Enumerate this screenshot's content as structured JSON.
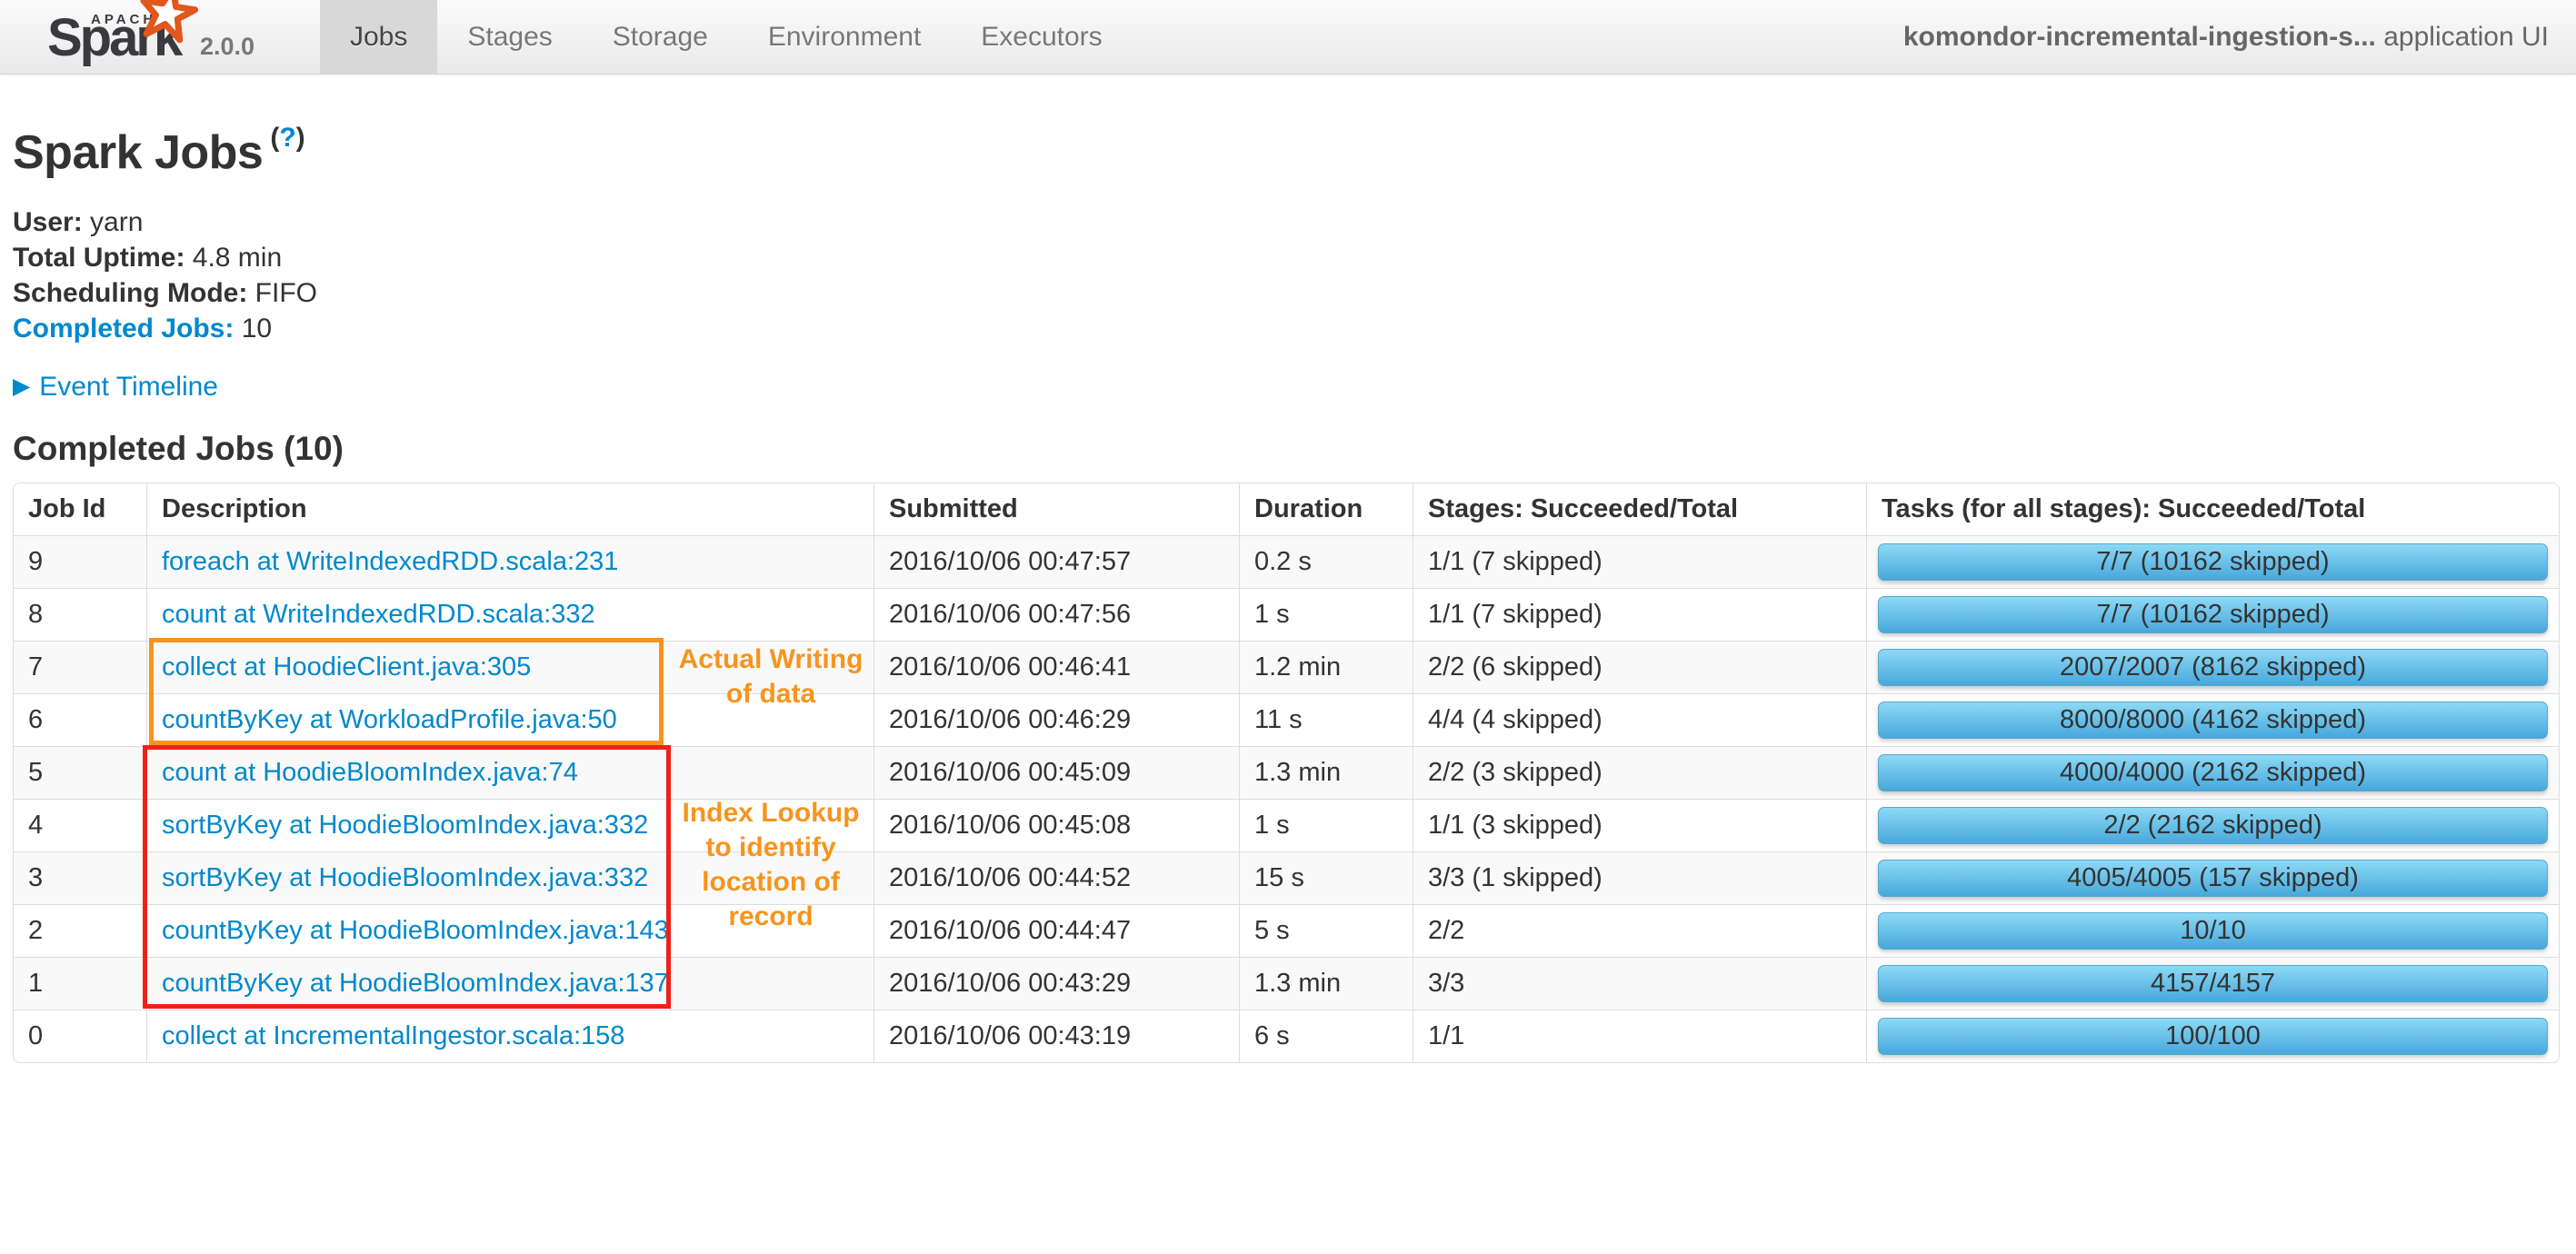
{
  "navbar": {
    "logo": {
      "apache": "APACHE",
      "name": "Spark",
      "version": "2.0.0"
    },
    "tabs": [
      {
        "label": "Jobs",
        "active": true
      },
      {
        "label": "Stages",
        "active": false
      },
      {
        "label": "Storage",
        "active": false
      },
      {
        "label": "Environment",
        "active": false
      },
      {
        "label": "Executors",
        "active": false
      }
    ],
    "app_name": "komondor-incremental-ingestion-s...",
    "app_suffix": " application UI"
  },
  "page": {
    "title": "Spark Jobs",
    "help_open_paren": "(",
    "help_question": "?",
    "help_close_paren": ")",
    "summary": [
      {
        "label": "User:",
        "value": "yarn",
        "link": false
      },
      {
        "label": "Total Uptime:",
        "value": "4.8 min",
        "link": false
      },
      {
        "label": "Scheduling Mode:",
        "value": "FIFO",
        "link": false
      },
      {
        "label": "Completed Jobs:",
        "value": "10",
        "link": true
      }
    ],
    "event_timeline_arrow": "▶",
    "event_timeline": "Event Timeline",
    "section_title": "Completed Jobs (10)"
  },
  "table": {
    "headers": [
      "Job Id",
      "Description",
      "Submitted",
      "Duration",
      "Stages: Succeeded/Total",
      "Tasks (for all stages): Succeeded/Total"
    ],
    "rows": [
      {
        "job_id": "9",
        "description": "foreach at WriteIndexedRDD.scala:231",
        "submitted": "2016/10/06 00:47:57",
        "duration": "0.2 s",
        "stages": "1/1 (7 skipped)",
        "tasks": "7/7 (10162 skipped)"
      },
      {
        "job_id": "8",
        "description": "count at WriteIndexedRDD.scala:332",
        "submitted": "2016/10/06 00:47:56",
        "duration": "1 s",
        "stages": "1/1 (7 skipped)",
        "tasks": "7/7 (10162 skipped)"
      },
      {
        "job_id": "7",
        "description": "collect at HoodieClient.java:305",
        "submitted": "2016/10/06 00:46:41",
        "duration": "1.2 min",
        "stages": "2/2 (6 skipped)",
        "tasks": "2007/2007 (8162 skipped)"
      },
      {
        "job_id": "6",
        "description": "countByKey at WorkloadProfile.java:50",
        "submitted": "2016/10/06 00:46:29",
        "duration": "11 s",
        "stages": "4/4 (4 skipped)",
        "tasks": "8000/8000 (4162 skipped)"
      },
      {
        "job_id": "5",
        "description": "count at HoodieBloomIndex.java:74",
        "submitted": "2016/10/06 00:45:09",
        "duration": "1.3 min",
        "stages": "2/2 (3 skipped)",
        "tasks": "4000/4000 (2162 skipped)"
      },
      {
        "job_id": "4",
        "description": "sortByKey at HoodieBloomIndex.java:332",
        "submitted": "2016/10/06 00:45:08",
        "duration": "1 s",
        "stages": "1/1 (3 skipped)",
        "tasks": "2/2 (2162 skipped)"
      },
      {
        "job_id": "3",
        "description": "sortByKey at HoodieBloomIndex.java:332",
        "submitted": "2016/10/06 00:44:52",
        "duration": "15 s",
        "stages": "3/3 (1 skipped)",
        "tasks": "4005/4005 (157 skipped)"
      },
      {
        "job_id": "2",
        "description": "countByKey at HoodieBloomIndex.java:143",
        "submitted": "2016/10/06 00:44:47",
        "duration": "5 s",
        "stages": "2/2",
        "tasks": "10/10"
      },
      {
        "job_id": "1",
        "description": "countByKey at HoodieBloomIndex.java:137",
        "submitted": "2016/10/06 00:43:29",
        "duration": "1.3 min",
        "stages": "3/3",
        "tasks": "4157/4157"
      },
      {
        "job_id": "0",
        "description": "collect at IncrementalIngestor.scala:158",
        "submitted": "2016/10/06 00:43:19",
        "duration": "6 s",
        "stages": "1/1",
        "tasks": "100/100"
      }
    ]
  },
  "annotations": {
    "writing": "Actual Writing of data",
    "lookup": "Index Lookup to identify location of record"
  },
  "colors": {
    "link": "#0088cc",
    "annotation_orange": "#f7941e",
    "annotation_red": "#ee2117",
    "progress_bar_top": "#8dd9f5",
    "progress_bar_bottom": "#47a8dc",
    "navbar_active_tab": "#d8d8d8",
    "spark_logo_star": "#e2571c"
  }
}
